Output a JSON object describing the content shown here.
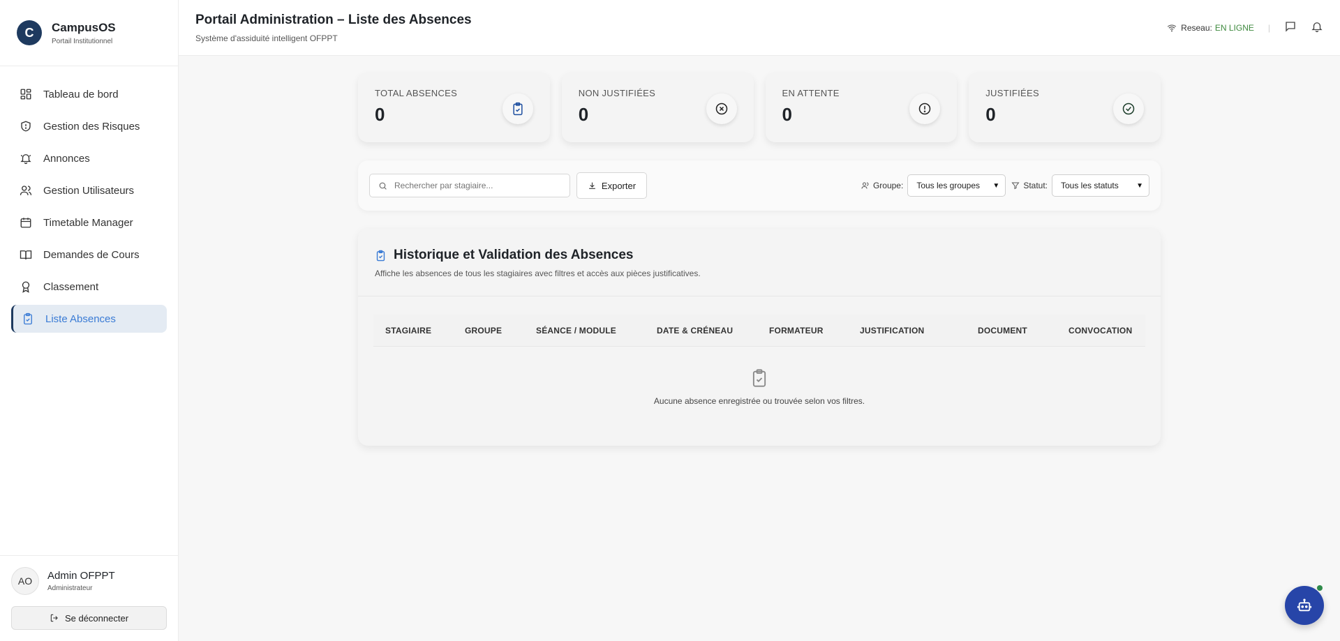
{
  "brand": {
    "logo_letter": "C",
    "name": "CampusOS",
    "subtitle": "Portail Institutionnel"
  },
  "sidebar": {
    "items": [
      {
        "label": "Tableau de bord",
        "icon": "dashboard-icon"
      },
      {
        "label": "Gestion des Risques",
        "icon": "shield-icon"
      },
      {
        "label": "Annonces",
        "icon": "bell-icon"
      },
      {
        "label": "Gestion Utilisateurs",
        "icon": "users-icon"
      },
      {
        "label": "Timetable Manager",
        "icon": "calendar-icon"
      },
      {
        "label": "Demandes de Cours",
        "icon": "book-icon"
      },
      {
        "label": "Classement",
        "icon": "award-icon"
      },
      {
        "label": "Liste Absences",
        "icon": "clipboard-check-icon",
        "active": true
      }
    ]
  },
  "user": {
    "initials": "AO",
    "name": "Admin OFPPT",
    "role": "Administrateur",
    "logout_label": "Se déconnecter"
  },
  "header": {
    "title": "Portail Administration – Liste des Absences",
    "subtitle": "Système d'assiduité intelligent OFPPT",
    "network_label": "Reseau:",
    "network_status": "EN LIGNE"
  },
  "stats": [
    {
      "label": "TOTAL ABSENCES",
      "value": "0",
      "icon": "clipboard-check-icon",
      "color": "#1e4fa0"
    },
    {
      "label": "NON JUSTIFIÉES",
      "value": "0",
      "icon": "x-circle-icon",
      "color": "#222222"
    },
    {
      "label": "EN ATTENTE",
      "value": "0",
      "icon": "alert-circle-icon",
      "color": "#222222"
    },
    {
      "label": "JUSTIFIÉES",
      "value": "0",
      "icon": "check-circle-icon",
      "color": "#1c3d2a"
    }
  ],
  "toolbar": {
    "search_placeholder": "Rechercher par stagiaire...",
    "export_label": "Exporter",
    "group_label": "Groupe:",
    "group_value": "Tous les groupes",
    "status_label": "Statut:",
    "status_value": "Tous les statuts"
  },
  "history": {
    "title": "Historique et Validation des Absences",
    "subtitle": "Affiche les absences de tous les stagiaires avec filtres et accès aux pièces justificatives.",
    "columns": [
      "STAGIAIRE",
      "GROUPE",
      "SÉANCE / MODULE",
      "DATE & CRÉNEAU",
      "FORMATEUR",
      "JUSTIFICATION",
      "DOCUMENT",
      "CONVOCATION"
    ],
    "empty_text": "Aucune absence enregistrée ou trouvée selon vos filtres."
  },
  "colors": {
    "brand": "#1e3a5f",
    "accent": "#3a7bd5",
    "online": "#3f8a3f",
    "fab": "#2745a8"
  }
}
